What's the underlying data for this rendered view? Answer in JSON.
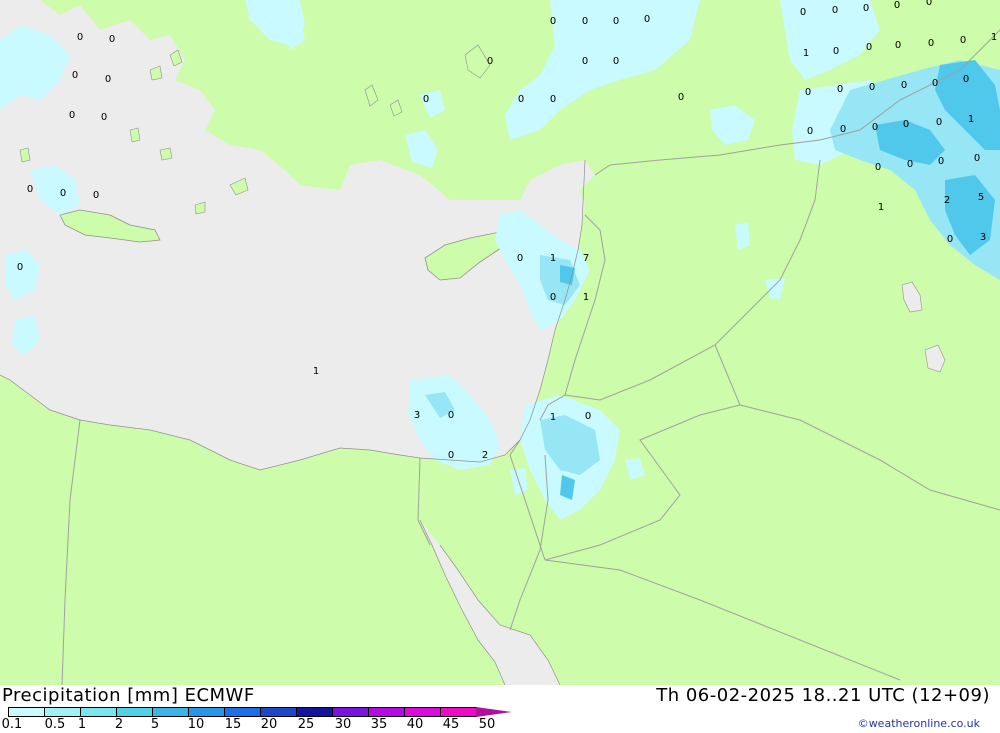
{
  "footer": {
    "title": "Precipitation [mm] ECMWF",
    "datetime": "Th 06-02-2025 18..21 UTC (12+09)",
    "credit": "©weatheronline.co.uk"
  },
  "legend": {
    "ticks": [
      "0.1",
      "0.5",
      "1",
      "2",
      "5",
      "10",
      "15",
      "20",
      "25",
      "30",
      "35",
      "40",
      "45",
      "50"
    ],
    "colors": [
      "#c8faff",
      "#a0f0f8",
      "#78e4ee",
      "#50d2e6",
      "#3cb4e6",
      "#2896e6",
      "#1e6ee6",
      "#1e46c8",
      "#1414a0",
      "#7814dc",
      "#b40ae6",
      "#dc0adc",
      "#f00ac8",
      "#b0109a"
    ]
  },
  "map": {
    "colors": {
      "land": "#cdfcaa",
      "sea": "#ececec",
      "precip_light": "#c8faff",
      "precip_medium": "#96e6f5",
      "precip_heavy": "#50c8eb",
      "border": "#a0a0a0"
    },
    "values": [
      {
        "text": "0"
      },
      {
        "text": "0"
      },
      {
        "text": "0"
      },
      {
        "text": "0"
      },
      {
        "text": "0"
      },
      {
        "text": "0"
      },
      {
        "text": "0"
      },
      {
        "text": "0"
      },
      {
        "text": "0"
      },
      {
        "text": "0"
      },
      {
        "text": "0"
      },
      {
        "text": "0"
      },
      {
        "text": "0"
      },
      {
        "text": "0"
      },
      {
        "text": "0"
      },
      {
        "text": "0"
      },
      {
        "text": "0"
      },
      {
        "text": "0"
      },
      {
        "text": "0"
      },
      {
        "text": "0"
      },
      {
        "text": "0"
      },
      {
        "text": "0"
      },
      {
        "text": "1"
      },
      {
        "text": "0"
      },
      {
        "text": "0"
      },
      {
        "text": "0"
      },
      {
        "text": "0"
      },
      {
        "text": "0"
      },
      {
        "text": "0"
      },
      {
        "text": "0"
      },
      {
        "text": "0"
      },
      {
        "text": "0"
      },
      {
        "text": "0"
      },
      {
        "text": "0"
      },
      {
        "text": "0"
      },
      {
        "text": "0"
      },
      {
        "text": "0"
      },
      {
        "text": "0"
      },
      {
        "text": "0"
      },
      {
        "text": "0"
      },
      {
        "text": "1"
      },
      {
        "text": "0"
      },
      {
        "text": "0"
      },
      {
        "text": "0"
      },
      {
        "text": "1"
      },
      {
        "text": "0"
      },
      {
        "text": "1"
      },
      {
        "text": "0"
      },
      {
        "text": "0"
      },
      {
        "text": "0"
      },
      {
        "text": "2"
      },
      {
        "text": "5"
      },
      {
        "text": "0"
      },
      {
        "text": "3"
      },
      {
        "text": "0"
      },
      {
        "text": "1"
      },
      {
        "text": "7"
      },
      {
        "text": "0"
      },
      {
        "text": "1"
      },
      {
        "text": "1"
      },
      {
        "text": "3"
      },
      {
        "text": "0"
      },
      {
        "text": "1"
      },
      {
        "text": "0"
      },
      {
        "text": "0"
      },
      {
        "text": "2"
      }
    ]
  }
}
